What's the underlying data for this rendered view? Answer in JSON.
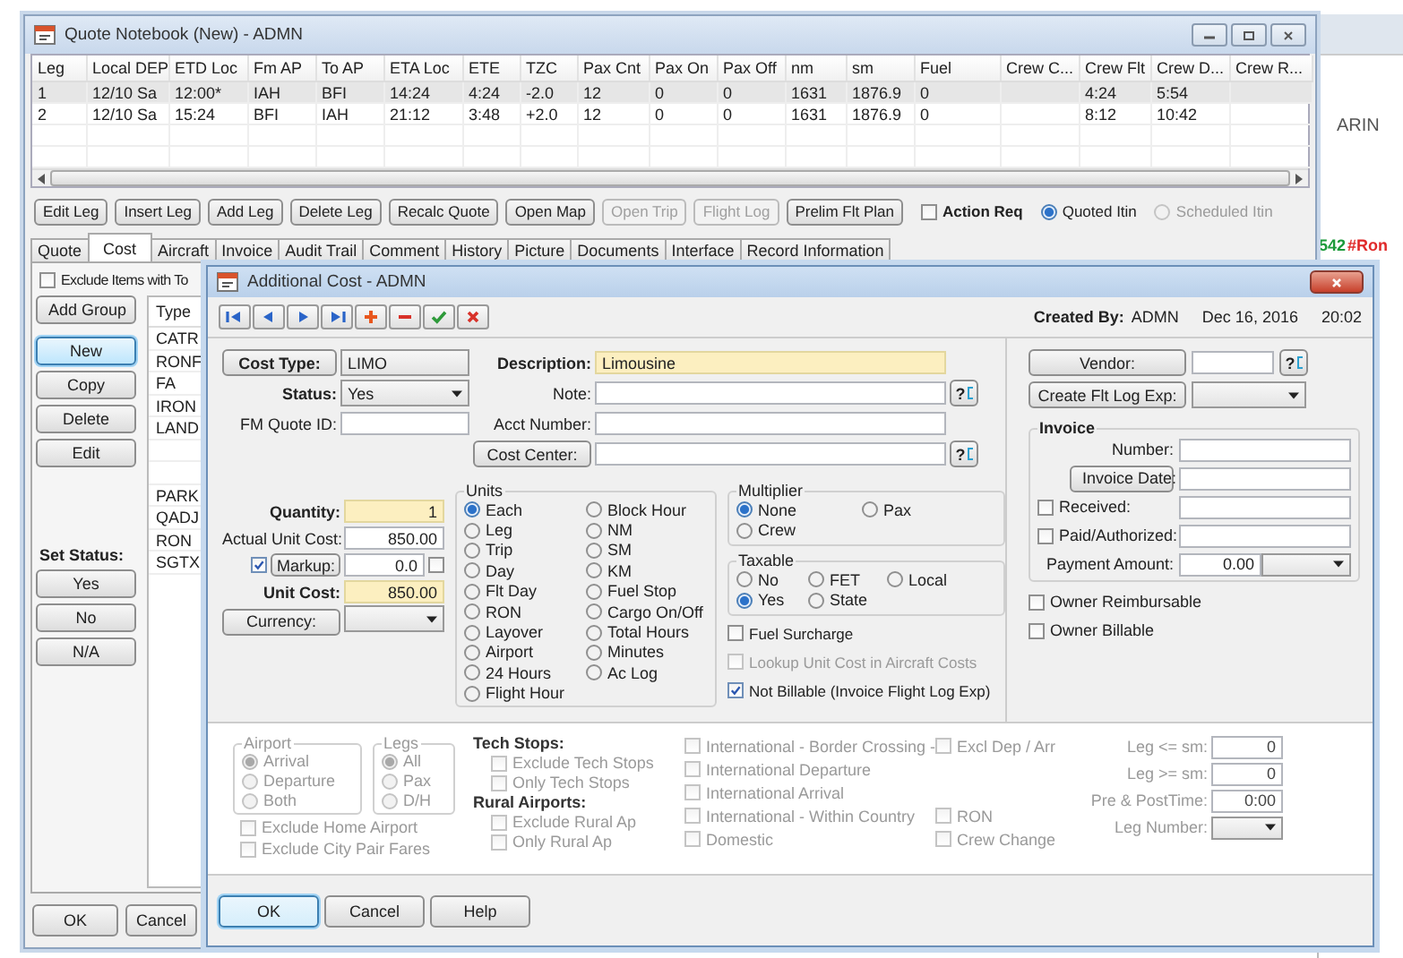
{
  "background_window": {
    "label": "ARIN",
    "count": "542",
    "tag": "#Ron"
  },
  "main_window": {
    "title": "Quote Notebook (New) - ADMN",
    "legs_table": {
      "columns": [
        "Leg",
        "Local DEP",
        "ETD Loc",
        "Fm AP",
        "To AP",
        "ETA Loc",
        "ETE",
        "TZC",
        "Pax Cnt",
        "Pax On",
        "Pax Off",
        "nm",
        "sm",
        "Fuel",
        "Crew C...",
        "Crew Flt",
        "Crew D...",
        "Crew R..."
      ],
      "rows": [
        {
          "selected": true,
          "cells": [
            "1",
            "12/10 Sa",
            "12:00*",
            "IAH",
            "BFI",
            "14:24",
            "4:24",
            "-2.0",
            "12",
            "0",
            "0",
            "1631",
            "1876.9",
            "0",
            null,
            "4:24",
            "5:54",
            null
          ]
        },
        {
          "selected": false,
          "cells": [
            "2",
            "12/10 Sa",
            "15:24",
            "BFI",
            "IAH",
            "21:12",
            "3:48",
            "+2.0",
            "12",
            "0",
            "0",
            "1631",
            "1876.9",
            "0",
            null,
            "8:12",
            "10:42",
            null
          ]
        }
      ]
    },
    "actions": [
      {
        "label": "Edit Leg",
        "disabled": false
      },
      {
        "label": "Insert Leg",
        "disabled": false
      },
      {
        "label": "Add Leg",
        "disabled": false
      },
      {
        "label": "Delete Leg",
        "disabled": false
      },
      {
        "label": "Recalc Quote",
        "disabled": false
      },
      {
        "label": "Open Map",
        "disabled": false
      },
      {
        "label": "Open Trip",
        "disabled": true
      },
      {
        "label": "Flight Log",
        "disabled": true
      },
      {
        "label": "Prelim Flt Plan",
        "disabled": false
      }
    ],
    "action_req": {
      "label": "Action Req",
      "checked": false
    },
    "itinerary": [
      {
        "label": "Quoted Itin",
        "selected": true,
        "disabled": false
      },
      {
        "label": "Scheduled Itin",
        "selected": false,
        "disabled": true
      }
    ],
    "tabs": [
      {
        "label": "Quote",
        "selected": false
      },
      {
        "label": "Cost",
        "selected": true
      },
      {
        "label": "Aircraft",
        "selected": false
      },
      {
        "label": "Invoice",
        "selected": false
      },
      {
        "label": "Audit Trail",
        "selected": false
      },
      {
        "label": "Comment",
        "selected": false
      },
      {
        "label": "History",
        "selected": false
      },
      {
        "label": "Picture",
        "selected": false
      },
      {
        "label": "Documents",
        "selected": false
      },
      {
        "label": "Interface",
        "selected": false
      },
      {
        "label": "Record Information",
        "selected": false
      }
    ],
    "exclude_items": {
      "label": "Exclude Items with To",
      "checked": false
    },
    "add_group": "Add Group",
    "side_buttons": [
      {
        "label": "New",
        "focused": true
      },
      {
        "label": "Copy",
        "focused": false
      },
      {
        "label": "Delete",
        "focused": false
      },
      {
        "label": "Edit",
        "focused": false
      }
    ],
    "set_status": {
      "label": "Set Status:",
      "buttons": [
        "Yes",
        "No",
        "N/A"
      ]
    },
    "type_list": {
      "header": "Type",
      "groups": [
        [
          "CATR",
          "RONF",
          "FA",
          "IRON",
          "LAND"
        ],
        [
          "PARK",
          "QADJ",
          "RON",
          "SGTX"
        ]
      ]
    },
    "buttons": [
      "OK",
      "Cancel"
    ]
  },
  "dialog": {
    "title": "Additional Cost - ADMN",
    "created_by": {
      "label": "Created By:",
      "user": "ADMN",
      "date": "Dec 16, 2016",
      "time": "20:02"
    },
    "cost_type": {
      "button": "Cost Type:",
      "value": "LIMO"
    },
    "description": {
      "label": "Description:",
      "value": "Limousine"
    },
    "status": {
      "label": "Status:",
      "value": "Yes"
    },
    "note": {
      "label": "Note:",
      "lookup": "?"
    },
    "fm_quote_id": {
      "label": "FM Quote ID:"
    },
    "acct_number": {
      "label": "Acct Number:"
    },
    "cost_center": {
      "button": "Cost Center:",
      "lookup": "?"
    },
    "quantity": {
      "label": "Quantity:",
      "value": "1"
    },
    "actual_unit_cost": {
      "label": "Actual Unit Cost:",
      "value": "850.00"
    },
    "markup": {
      "button": "Markup:",
      "checked": true,
      "value": "0.0",
      "percent_checked": false
    },
    "unit_cost": {
      "label": "Unit Cost:",
      "value": "850.00"
    },
    "currency": {
      "button": "Currency:"
    },
    "units": {
      "title": "Units",
      "options": [
        {
          "label": "Each",
          "selected": true
        },
        {
          "label": "Leg",
          "selected": false
        },
        {
          "label": "Trip",
          "selected": false
        },
        {
          "label": "Day",
          "selected": false
        },
        {
          "label": "Flt Day",
          "selected": false
        },
        {
          "label": "RON",
          "selected": false
        },
        {
          "label": "Layover",
          "selected": false
        },
        {
          "label": "Airport",
          "selected": false
        },
        {
          "label": "24 Hours",
          "selected": false
        },
        {
          "label": "Flight Hour",
          "selected": false
        },
        {
          "label": "Block Hour",
          "selected": false
        },
        {
          "label": "NM",
          "selected": false
        },
        {
          "label": "SM",
          "selected": false
        },
        {
          "label": "KM",
          "selected": false
        },
        {
          "label": "Fuel Stop",
          "selected": false
        },
        {
          "label": "Cargo On/Off",
          "selected": false
        },
        {
          "label": "Total Hours",
          "selected": false
        },
        {
          "label": "Minutes",
          "selected": false
        },
        {
          "label": "Ac Log",
          "selected": false
        }
      ]
    },
    "multiplier": {
      "title": "Multiplier",
      "options": [
        {
          "label": "None",
          "selected": true
        },
        {
          "label": "Pax",
          "selected": false
        },
        {
          "label": "Crew",
          "selected": false
        }
      ]
    },
    "taxable": {
      "title": "Taxable",
      "options": [
        {
          "label": "No",
          "selected": false
        },
        {
          "label": "FET",
          "selected": false
        },
        {
          "label": "Local",
          "selected": false
        },
        {
          "label": "Yes",
          "selected": true
        },
        {
          "label": "State",
          "selected": false
        }
      ]
    },
    "options": [
      {
        "label": "Fuel Surcharge",
        "checked": false,
        "disabled": false
      },
      {
        "label": "Lookup Unit Cost in Aircraft Costs",
        "checked": false,
        "disabled": true
      },
      {
        "label": "Not Billable (Invoice Flight Log Exp)",
        "checked": true,
        "disabled": false
      }
    ],
    "vendor": {
      "button": "Vendor:",
      "lookup": "?"
    },
    "create_flt_log_exp": {
      "button": "Create Flt Log Exp:"
    },
    "invoice": {
      "title": "Invoice",
      "number_label": "Number:",
      "date_button": "Invoice Date:",
      "received": {
        "label": "Received:",
        "checked": false
      },
      "paid": {
        "label": "Paid/Authorized:",
        "checked": false
      },
      "payment_label": "Payment Amount:",
      "payment_value": "0.00"
    },
    "owner_options": [
      {
        "label": "Owner Reimbursable",
        "checked": false
      },
      {
        "label": "Owner Billable",
        "checked": false
      }
    ],
    "filters": {
      "disabled": true,
      "airport": {
        "title": "Airport",
        "options": [
          {
            "label": "Arrival",
            "selected": true
          },
          {
            "label": "Departure",
            "selected": false
          },
          {
            "label": "Both",
            "selected": false
          }
        ]
      },
      "legs": {
        "title": "Legs",
        "options": [
          {
            "label": "All",
            "selected": true
          },
          {
            "label": "Pax",
            "selected": false
          },
          {
            "label": "D/H",
            "selected": false
          }
        ]
      },
      "airport_checks": [
        {
          "label": "Exclude Home Airport",
          "checked": false
        },
        {
          "label": "Exclude City Pair Fares",
          "checked": false
        }
      ],
      "tech_stops": {
        "title": "Tech Stops:",
        "checks": [
          {
            "label": "Exclude Tech Stops",
            "checked": false
          },
          {
            "label": "Only Tech Stops",
            "checked": false
          }
        ]
      },
      "rural_airports": {
        "title": "Rural Airports:",
        "checks": [
          {
            "label": "Exclude Rural Ap",
            "checked": false
          },
          {
            "label": "Only Rural Ap",
            "checked": false
          }
        ]
      },
      "international": [
        {
          "label": "International - Border Crossing -",
          "checked": false,
          "extra": {
            "label": "Excl Dep / Arr",
            "checked": false
          }
        },
        {
          "label": "International Departure",
          "checked": false
        },
        {
          "label": "International Arrival",
          "checked": false
        },
        {
          "label": "International - Within Country",
          "checked": false,
          "extra": {
            "label": "RON",
            "checked": false
          }
        },
        {
          "label": "Domestic",
          "checked": false,
          "extra": {
            "label": "Crew Change",
            "checked": false
          }
        }
      ],
      "limits": [
        {
          "label": "Leg <= sm:",
          "kind": "text",
          "value": "0"
        },
        {
          "label": "Leg >= sm:",
          "kind": "text",
          "value": "0"
        },
        {
          "label": "Pre & PostTime:",
          "kind": "text",
          "value": "0:00"
        },
        {
          "label": "Leg Number:",
          "kind": "dropdown"
        }
      ]
    },
    "buttons": [
      {
        "label": "OK",
        "default": true
      },
      {
        "label": "Cancel",
        "default": false
      },
      {
        "label": "Help",
        "default": false
      }
    ]
  }
}
